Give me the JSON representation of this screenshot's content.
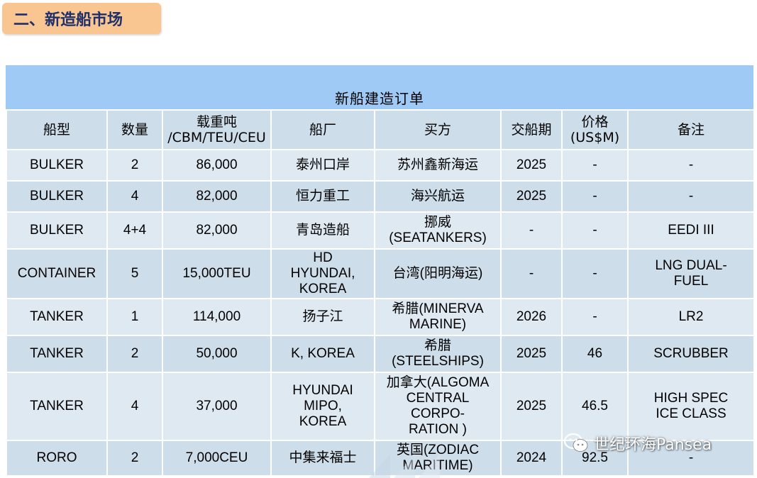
{
  "section": {
    "title": "二、新造船市场"
  },
  "table": {
    "title": "新船建造订单",
    "headers": [
      "船型",
      "数量",
      "载重吨\n/CBM/TEU/CEU",
      "船厂",
      "买方",
      "交船期",
      "价格\n(US$M)",
      "备注"
    ],
    "rows": [
      [
        "BULKER",
        "2",
        "86,000",
        "泰州口岸",
        "苏州鑫新海运",
        "2025",
        "-",
        "-"
      ],
      [
        "BULKER",
        "4",
        "82,000",
        "恒力重工",
        "海兴航运",
        "2025",
        "-",
        "-"
      ],
      [
        "BULKER",
        "4+4",
        "82,000",
        "青岛造船",
        "挪威\n(SEATANKERS)",
        "-",
        "-",
        "EEDI III"
      ],
      [
        "CONTAINER",
        "5",
        "15,000TEU",
        "HD\nHYUNDAI,\nKOREA",
        "台湾(阳明海运)",
        "-",
        "-",
        "LNG DUAL-\nFUEL"
      ],
      [
        "TANKER",
        "1",
        "114,000",
        "扬子江",
        "希腊(MINERVA\nMARINE)",
        "2026",
        "-",
        "LR2"
      ],
      [
        "TANKER",
        "2",
        "50,000",
        "K, KOREA",
        "希腊\n(STEELSHIPS)",
        "2025",
        "46",
        "SCRUBBER"
      ],
      [
        "TANKER",
        "4",
        "37,000",
        "HYUNDAI\nMIPO,\nKOREA",
        "加拿大(ALGOMA\nCENTRAL\nCORPO-\nRATION )",
        "2025",
        "46.5",
        "HIGH SPEC\nICE CLASS"
      ],
      [
        "RORO",
        "2",
        "7,000CEU",
        "中集来福士",
        "英国(ZODIAC\nMARITIME)",
        "2024",
        "92.5",
        "-"
      ]
    ]
  },
  "watermark": {
    "text": "世纪环海Pansea",
    "icon": "wechat-icon"
  }
}
